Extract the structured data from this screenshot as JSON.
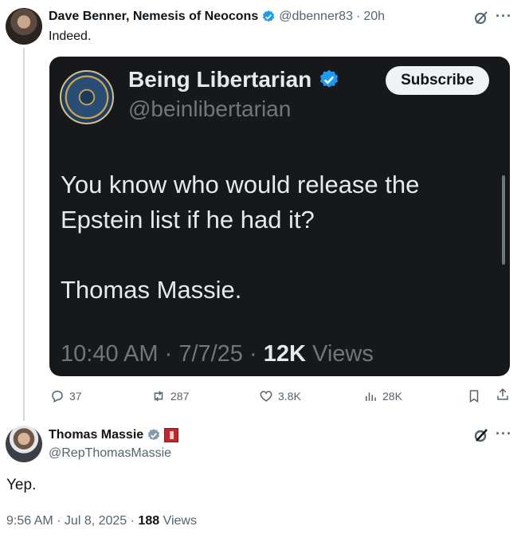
{
  "reply_post": {
    "author_name": "Dave Benner, Nemesis of Neocons",
    "handle": "@dbenner83",
    "time": "20h",
    "text": "Indeed.",
    "separator": "·"
  },
  "quoted_post": {
    "author_name": "Being Libertarian",
    "handle": "@beinlibertarian",
    "subscribe_label": "Subscribe",
    "paragraphs": [
      "You know who would release the Epstein list if he had it?",
      "Thomas Massie."
    ],
    "time": "10:40 AM",
    "date": "7/7/25",
    "views_count": "12K",
    "views_label": "Views"
  },
  "actions": {
    "replies": "37",
    "reposts": "287",
    "likes": "3.8K",
    "views": "28K"
  },
  "main_post": {
    "author_name": "Thomas Massie",
    "handle": "@RepThomasMassie",
    "text": "Yep.",
    "time": "9:56 AM",
    "date": "Jul 8, 2025",
    "views_count": "188",
    "views_label": "Views"
  },
  "colors": {
    "verified_blue": "#1d9bf0",
    "verified_gray": "#829aab",
    "card_bg": "#16181c",
    "muted": "#536471"
  },
  "icons": [
    "reply-icon",
    "repost-icon",
    "like-icon",
    "views-icon",
    "bookmark-icon",
    "share-icon",
    "grok-icon",
    "more-icon"
  ]
}
